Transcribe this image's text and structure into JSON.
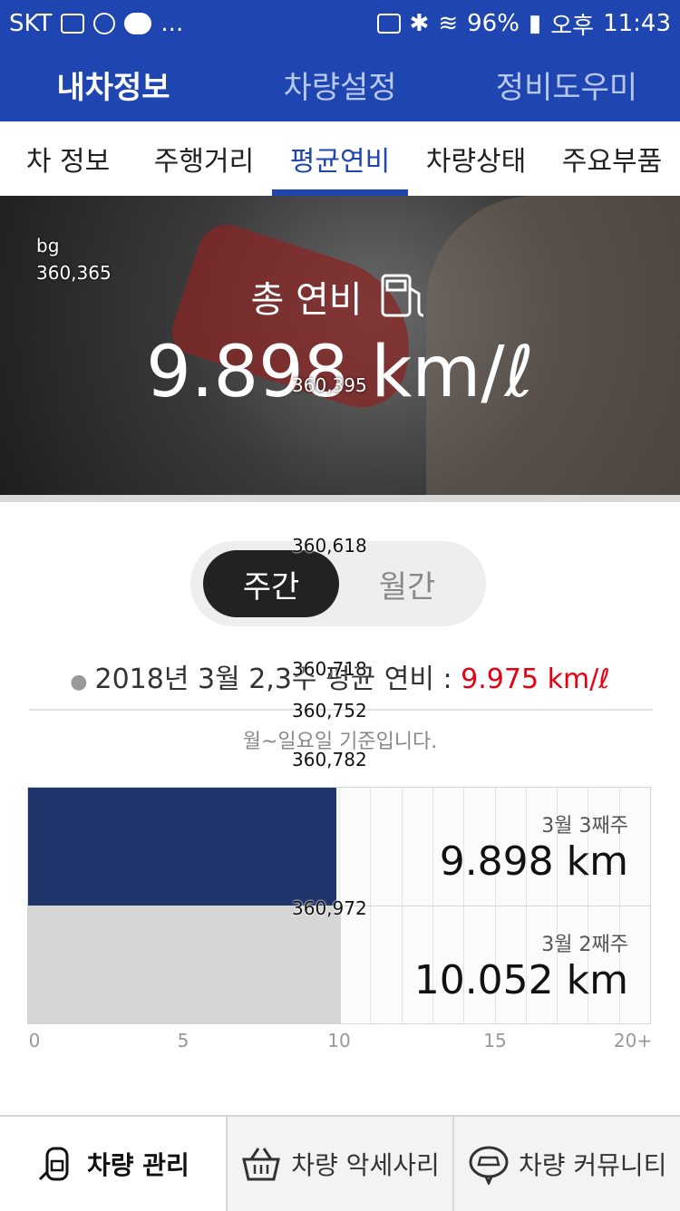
{
  "statusbar": {
    "carrier": "SKT",
    "extra": "...",
    "battery": "96%",
    "ampm": "오후",
    "time": "11:43"
  },
  "topnav": [
    {
      "label": "내차정보",
      "active": true
    },
    {
      "label": "차량설정",
      "active": false
    },
    {
      "label": "정비도우미",
      "active": false
    }
  ],
  "subtabs": [
    {
      "label": "차 정보",
      "active": false
    },
    {
      "label": "주행거리",
      "active": false
    },
    {
      "label": "평균연비",
      "active": true
    },
    {
      "label": "차량상태",
      "active": false
    },
    {
      "label": "주요부품",
      "active": false
    }
  ],
  "hero": {
    "debug_label": "bg",
    "debug_coords": "360,365",
    "title": "총 연비",
    "value": "9.898 km/ℓ",
    "value_debug": "360,395"
  },
  "period_toggle": {
    "weekly": "주간",
    "monthly": "월간",
    "debug": "360,618"
  },
  "summary": {
    "text": "2018년 3월 2,3주 평균 연비 : ",
    "value": "9.975 km/ℓ",
    "debug": "360,718",
    "debug2": "360,752",
    "debug3": "360,782"
  },
  "note": "월~일요일 기준입니다.",
  "chart_debug": "360,972",
  "chart_data": {
    "type": "bar",
    "orientation": "horizontal",
    "categories": [
      "3월 3째주",
      "3월 2째주"
    ],
    "values": [
      9.898,
      10.052
    ],
    "value_labels": [
      "9.898 km",
      "10.052 km"
    ],
    "xlim": [
      0,
      20
    ],
    "tick_labels": [
      "0",
      "5",
      "10",
      "15",
      "20+"
    ],
    "tick_values": [
      0,
      5,
      10,
      15,
      20
    ],
    "colors": [
      "#1f346b",
      "#d5d5d5"
    ],
    "grid": true
  },
  "bottomnav": [
    {
      "label": "차량 관리",
      "icon": "car-manage-icon",
      "active": true
    },
    {
      "label": "차량 악세사리",
      "icon": "basket-icon",
      "active": false
    },
    {
      "label": "차량 커뮤니티",
      "icon": "car-chat-icon",
      "active": false
    }
  ],
  "colors": {
    "primary": "#1e45b0",
    "accent": "#e60012",
    "bar_current": "#1f346b",
    "bar_previous": "#d5d5d5"
  }
}
